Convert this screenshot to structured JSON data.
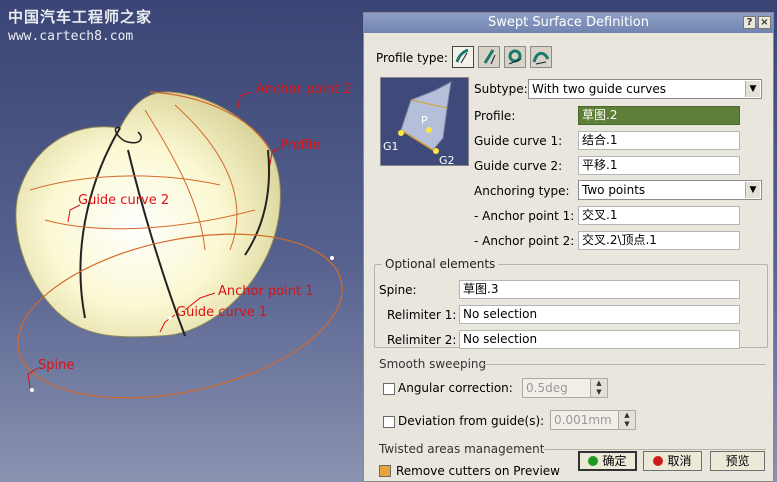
{
  "watermark": {
    "line1": "中国汽车工程师之家",
    "line2": "www.cartech8.com"
  },
  "viewport_labels": {
    "anchor_point_2": "Anchor point 2",
    "profile": "Profile",
    "guide_curve_2": "Guide curve 2",
    "anchor_point_1": "Anchor point 1",
    "guide_curve_1": "Guide curve 1",
    "spine": "Spine"
  },
  "dialog": {
    "title": "Swept Surface Definition",
    "profile_type_label": "Profile type:",
    "profile_type_icons": [
      "explicit-profile-icon",
      "line-profile-icon",
      "circle-profile-icon",
      "conic-profile-icon"
    ],
    "preview_labels": {
      "g1": "G1",
      "g2": "G2",
      "p": "P"
    },
    "subtype_label": "Subtype:",
    "subtype_value": "With two guide curves",
    "profile_label": "Profile:",
    "profile_value": "草图.2",
    "guide1_label": "Guide curve 1:",
    "guide1_value": "结合.1",
    "guide2_label": "Guide curve 2:",
    "guide2_value": "平移.1",
    "anchoring_label": "Anchoring type:",
    "anchoring_value": "Two points",
    "anchor1_label": "- Anchor point 1:",
    "anchor1_value": "交叉.1",
    "anchor2_label": "- Anchor point 2:",
    "anchor2_value": "交叉.2\\顶点.1",
    "optional_title": "Optional elements",
    "spine_label": "Spine:",
    "spine_value": "草图.3",
    "relim1_label": "Relimiter 1:",
    "relim1_value": "No selection",
    "relim2_label": "Relimiter 2:",
    "relim2_value": "No selection",
    "smooth_title": "Smooth sweeping",
    "angular_label": "Angular correction:",
    "angular_value": "0.5deg",
    "deviation_label": "Deviation from guide(s):",
    "deviation_value": "0.001mm",
    "twisted_title": "Twisted areas management",
    "remove_cutters_label": "Remove cutters on Preview",
    "ok_label": "确定",
    "cancel_label": "取消",
    "preview_label": "预览",
    "colors": {
      "selected_field": "#5e7f38",
      "ok_dot": "#1f9a1f",
      "cancel_dot": "#cc1b1b"
    }
  }
}
